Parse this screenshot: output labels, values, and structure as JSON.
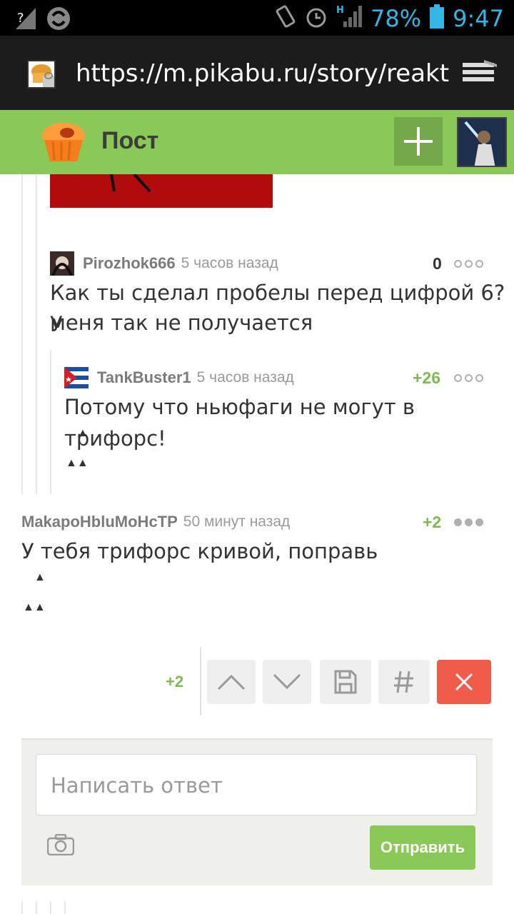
{
  "status_bar": {
    "battery_percent": "78%",
    "time": "9:47",
    "network_label": "H"
  },
  "browser": {
    "url": "https://m.pikabu.ru/story/reakt"
  },
  "header": {
    "title": "Пост",
    "accent_color": "#8ac858"
  },
  "comments": [
    {
      "author": "Pirozhok666",
      "time": "5 часов назад",
      "rating": "0",
      "text_line1": "Как ты сделал пробелы перед цифрой 6?У",
      "text_line2": "меня так не получается"
    },
    {
      "author": "TankBuster1",
      "time": "5 часов назад",
      "rating": "+26",
      "text": "Потому что ньюфаги не могут в трифорс!",
      "triforce_top": "▲",
      "triforce_bottom": "▲▲"
    },
    {
      "author": "MakapoHbluMoHcTP",
      "time": "50 минут назад",
      "rating": "+2",
      "text": "У тебя трифорс кривой, поправь",
      "triforce_top": "▲",
      "triforce_bottom": "▲▲"
    }
  ],
  "actions": {
    "score": "+2"
  },
  "reply": {
    "placeholder": "Написать ответ",
    "send_label": "Отправить"
  }
}
